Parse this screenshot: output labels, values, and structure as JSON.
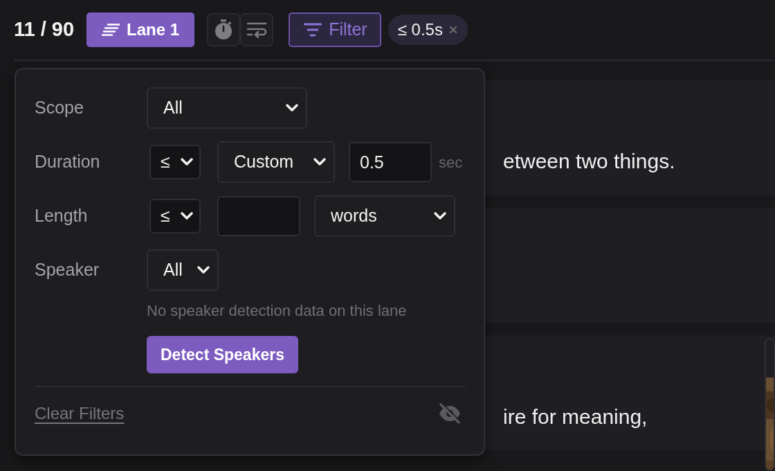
{
  "toolbar": {
    "counter": "11 / 90",
    "lane_button": "Lane 1",
    "timer_toggle": {
      "on": false
    },
    "wrap_toggle": {
      "on": false
    },
    "filter_button": {
      "label": "Filter",
      "active": true
    },
    "chip": {
      "label": "≤ 0.5s",
      "close": "×"
    }
  },
  "cards": [
    {
      "kind": "text",
      "text": "etween two things."
    },
    {
      "kind": "blank"
    },
    {
      "kind": "text",
      "text": "ire for meaning,"
    }
  ],
  "filter_panel": {
    "rows": [
      {
        "label": "Scope",
        "controls": [
          {
            "kind": "select",
            "value": "All"
          }
        ]
      },
      {
        "label": "Duration",
        "controls": [
          {
            "kind": "operator",
            "value": "≤"
          },
          {
            "kind": "select",
            "value": "Custom"
          },
          {
            "kind": "input",
            "value": "0.5"
          },
          {
            "kind": "unit",
            "text": "sec"
          }
        ]
      },
      {
        "label": "Length",
        "controls": [
          {
            "kind": "operator",
            "value": "≤"
          },
          {
            "kind": "input"
          },
          {
            "kind": "select",
            "value": "words"
          }
        ]
      },
      {
        "label": "Speaker",
        "controls": [
          {
            "kind": "select",
            "value": "All"
          }
        ],
        "note": "No speaker detection data on this lane",
        "button": "Detect Speakers"
      }
    ],
    "clear_link": "Clear Filters"
  }
}
